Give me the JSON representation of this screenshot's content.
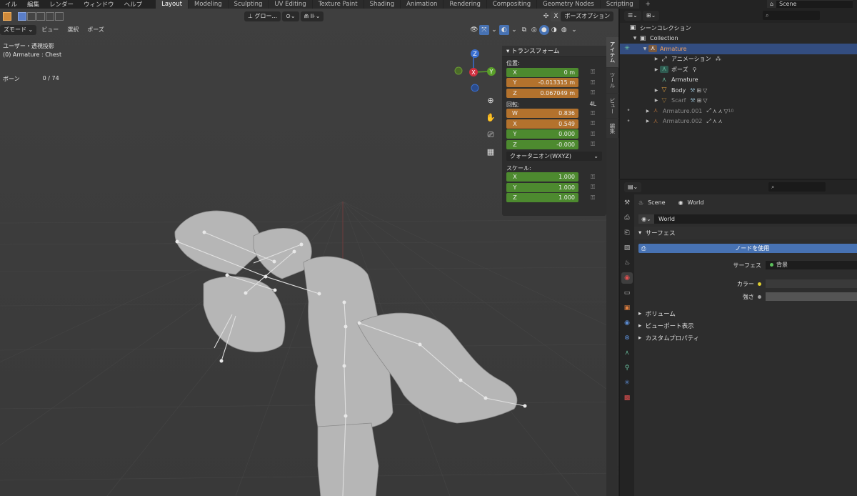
{
  "menu": [
    "イル",
    "編集",
    "レンダー",
    "ウィンドウ",
    "ヘルプ"
  ],
  "workspaces": [
    "Layout",
    "Modeling",
    "Sculpting",
    "UV Editing",
    "Texture Paint",
    "Shading",
    "Animation",
    "Rendering",
    "Compositing",
    "Geometry Nodes",
    "Scripting"
  ],
  "active_workspace": "Layout",
  "scene_name": "Scene",
  "viewport": {
    "orientation": "グロー...",
    "pose_options": "ポーズオプション",
    "mode": "ズモード",
    "menus": [
      "ビュー",
      "選択",
      "ポーズ"
    ],
    "info_line1": "ユーザー・透視投影",
    "info_line2": "(0) Armature : Chest",
    "bones_label": "ボーン",
    "bones_value": "0 / 74",
    "gizmo": {
      "z": "Z",
      "x": "X",
      "y": "Y"
    }
  },
  "transform_panel": {
    "title": "トランスフォーム",
    "location_label": "位置:",
    "location": [
      {
        "axis": "X",
        "value": "0 m"
      },
      {
        "axis": "Y",
        "value": "-0.013315 m"
      },
      {
        "axis": "Z",
        "value": "0.067049 m"
      }
    ],
    "rotation_label": "回転:",
    "rotation_mode_short": "4L",
    "rotation": [
      {
        "axis": "W",
        "value": "0.836"
      },
      {
        "axis": "X",
        "value": "0.549"
      },
      {
        "axis": "Y",
        "value": "0.000"
      },
      {
        "axis": "Z",
        "value": "-0.000"
      }
    ],
    "rotation_mode": "クォータニオン(WXYZ)",
    "scale_label": "スケール:",
    "scale": [
      {
        "axis": "X",
        "value": "1.000"
      },
      {
        "axis": "Y",
        "value": "1.000"
      },
      {
        "axis": "Z",
        "value": "1.000"
      }
    ]
  },
  "side_tabs": [
    "アイテム",
    "ツール",
    "ビュー",
    "編集"
  ],
  "outliner": {
    "scene_collection": "シーンコレクション",
    "collection": "Collection",
    "items": [
      {
        "label": "Armature",
        "selected": true
      },
      {
        "label": "アニメーション"
      },
      {
        "label": "ポーズ"
      },
      {
        "label": "Armature"
      },
      {
        "label": "Body"
      },
      {
        "label": "Scarf"
      },
      {
        "label": "Armature.001"
      },
      {
        "label": "Armature.002"
      }
    ],
    "badge_count": "10"
  },
  "properties": {
    "crumb_scene": "Scene",
    "crumb_world": "World",
    "world_name": "World",
    "surface_panel": "サーフェス",
    "use_nodes": "ノードを使用",
    "surface_label": "サーフェス",
    "surface_value": "背景",
    "color_label": "カラー",
    "strength_label": "強さ",
    "volume_panel": "ボリューム",
    "viewport_panel": "ビューポート表示",
    "custom_props_panel": "カスタムプロパティ"
  },
  "colors": {
    "accent_blue": "#4772b3",
    "loc_green": "#4d8a2f",
    "rot_orange": "#b3722d",
    "selected_row": "#334d80"
  }
}
